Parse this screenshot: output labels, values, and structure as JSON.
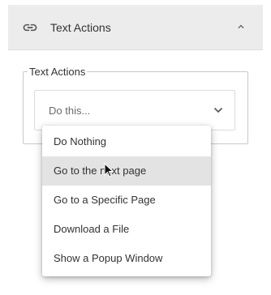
{
  "section": {
    "title": "Text Actions",
    "icon": "link-icon",
    "toggle_icon": "chevron-up-icon",
    "background": "#ececec"
  },
  "field": {
    "legend": "Text Actions",
    "selected_value": "Do this...",
    "dropdown_icon": "chevron-down-icon"
  },
  "menu": {
    "hovered_index": 1,
    "items": [
      {
        "label": "Do Nothing"
      },
      {
        "label": "Go to the next page"
      },
      {
        "label": "Go to a Specific Page"
      },
      {
        "label": "Download a File"
      },
      {
        "label": "Show a Popup Window"
      }
    ]
  },
  "cursor": {
    "icon": "mouse-pointer-icon"
  }
}
